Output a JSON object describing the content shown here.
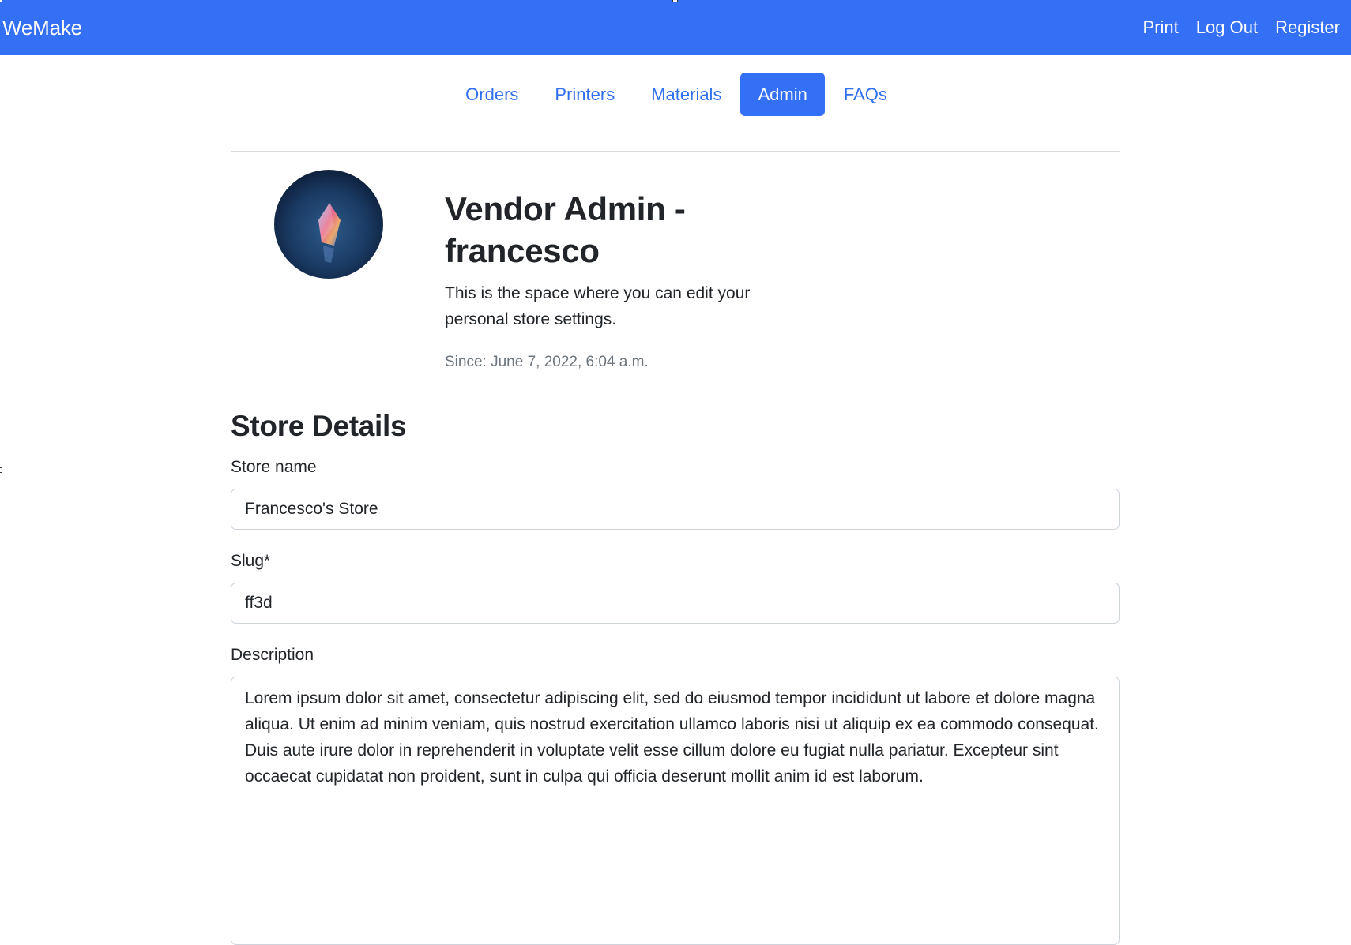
{
  "navbar": {
    "brand": "WeMake",
    "links": [
      "Print",
      "Log Out",
      "Register"
    ]
  },
  "tabs": [
    {
      "label": "Orders",
      "active": false
    },
    {
      "label": "Printers",
      "active": false
    },
    {
      "label": "Materials",
      "active": false
    },
    {
      "label": "Admin",
      "active": true
    },
    {
      "label": "FAQs",
      "active": false
    }
  ],
  "profile": {
    "title": "Vendor Admin - francesco",
    "description": "This is the space where you can edit your personal store settings.",
    "since": "Since: June 7, 2022, 6:04 a.m."
  },
  "store_details": {
    "heading": "Store Details",
    "store_name_label": "Store name",
    "store_name_value": "Francesco's Store",
    "slug_label": "Slug*",
    "slug_value": "ff3d",
    "description_label": "Description",
    "description_value": "Lorem ipsum dolor sit amet, consectetur adipiscing elit, sed do eiusmod tempor incididunt ut labore et dolore magna aliqua. Ut enim ad minim veniam, quis nostrud exercitation ullamco laboris nisi ut aliquip ex ea commodo consequat. Duis aute irure dolor in reprehenderit in voluptate velit esse cillum dolore eu fugiat nulla pariatur. Excepteur sint occaecat cupidatat non proident, sunt in culpa qui officia deserunt mollit anim id est laborum."
  },
  "colors": {
    "primary": "#3470f5",
    "link": "#2f6ff0",
    "muted": "#6c757d"
  }
}
